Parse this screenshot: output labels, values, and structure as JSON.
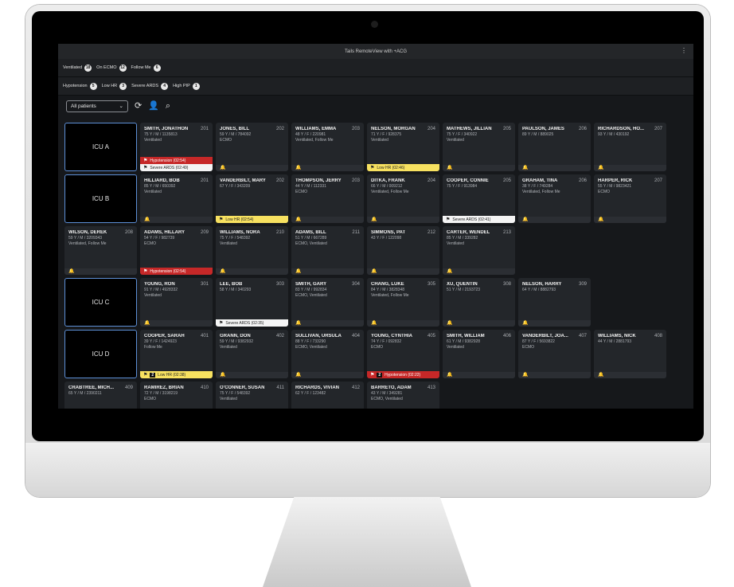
{
  "app": {
    "title": "Tails RemoteView with +ACG"
  },
  "filters_row1": [
    {
      "label": "Ventilated",
      "count": "18"
    },
    {
      "label": "On ECMO",
      "count": "12"
    },
    {
      "label": "Follow Me",
      "count": "6"
    }
  ],
  "filters_row2": [
    {
      "label": "Hypotension",
      "count": "5"
    },
    {
      "label": "Low HR",
      "count": "3"
    },
    {
      "label": "Severe ARDS",
      "count": "4"
    },
    {
      "label": "High PIP",
      "count": "1"
    }
  ],
  "toolbar": {
    "patient_filter": "All patients"
  },
  "grid": [
    [
      {
        "icu": "ICU A"
      },
      {
        "name": "SMITH, JONATHON",
        "bed": "201",
        "demo": "75 Y / M / 1135813",
        "status": "Ventilated",
        "alerts": [
          {
            "type": "red",
            "text": "Hypotension (02:54)"
          },
          {
            "type": "white",
            "text": "Severe ARDS (02:49)"
          }
        ]
      },
      {
        "name": "JONES, BILL",
        "bed": "202",
        "demo": "59 Y / M / 784092",
        "status": "ECMO",
        "alerts": []
      },
      {
        "name": "WILLIAMS, EMMA",
        "bed": "203",
        "demo": "48 Y / F / 220981",
        "status": "Ventilated, Follow Me",
        "alerts": []
      },
      {
        "name": "NELSON, MORGAN",
        "bed": "204",
        "demo": "71 Y / F / 928375",
        "status": "Ventilated",
        "alerts": [
          {
            "type": "yellow",
            "text": "Low HR (02:46)"
          }
        ]
      },
      {
        "name": "MATHEWS, JILLIAN",
        "bed": "205",
        "demo": "75 Y / F / 340922",
        "status": "Ventilated",
        "alerts": []
      },
      {
        "name": "PAULSON, JAMES",
        "bed": "206",
        "demo": "89 Y / M / 889025",
        "status": "",
        "alerts": []
      },
      {
        "name": "RICHARDSON, HO...",
        "bed": "207",
        "demo": "93 Y / M / 430192",
        "status": "",
        "alerts": []
      }
    ],
    [
      {
        "icu": "ICU B"
      },
      {
        "name": "HILLIARD, BOB",
        "bed": "201",
        "demo": "85 Y / M / 650392",
        "status": "Ventilated",
        "alerts": []
      },
      {
        "name": "VANDERBILT, MARY",
        "bed": "202",
        "demo": "67 Y / F / 343209",
        "status": "",
        "alerts": [
          {
            "type": "yellow",
            "text": "Low HR (02:54)"
          }
        ]
      },
      {
        "name": "THOMPSON, JERRY",
        "bed": "203",
        "demo": "44 Y / M / 112331",
        "status": "ECMO",
        "alerts": []
      },
      {
        "name": "DITKA, FRANK",
        "bed": "204",
        "demo": "66 Y / M / 009212",
        "status": "Ventilated, Follow Me",
        "alerts": []
      },
      {
        "name": "COOPER, CONNIE",
        "bed": "205",
        "demo": "75 Y / F / 913984",
        "status": "",
        "alerts": [
          {
            "type": "white",
            "text": "Severe ARDS (02:41)"
          }
        ]
      },
      {
        "name": "GRAHAM, TINA",
        "bed": "206",
        "demo": "38 Y / F / 749284",
        "status": "Ventilated, Follow Me",
        "alerts": []
      },
      {
        "name": "HARPER, RICK",
        "bed": "207",
        "demo": "55 Y / M / 9823421",
        "status": "ECMO",
        "alerts": []
      }
    ],
    [
      {
        "name": "WILSON, DEREK",
        "bed": "208",
        "demo": "59 Y / M / 3209343",
        "status": "Ventilated, Follow Me",
        "alerts": []
      },
      {
        "name": "ADAMS, HILLARY",
        "bed": "209",
        "demo": "54 Y / F / 982739",
        "status": "ECMO",
        "alerts": [
          {
            "type": "red",
            "text": "Hypotension (02:54)"
          }
        ]
      },
      {
        "name": "WILLIAMS, NORA",
        "bed": "210",
        "demo": "75 Y / F / 548392",
        "status": "Ventilated",
        "alerts": []
      },
      {
        "name": "ADAMS, BILL",
        "bed": "211",
        "demo": "51 Y / M / 667289",
        "status": "ECMO, Ventilated",
        "alerts": []
      },
      {
        "name": "SIMMONS, PAT",
        "bed": "212",
        "demo": "43 Y / F / 122098",
        "status": "",
        "alerts": []
      },
      {
        "name": "CARTER, WENDEL",
        "bed": "213",
        "demo": "85 Y / M / 339282",
        "status": "Ventilated",
        "alerts": []
      },
      {
        "empty": true
      },
      {
        "empty": true
      }
    ],
    [
      {
        "icu": "ICU C"
      },
      {
        "name": "YOUNG, RON",
        "bed": "301",
        "demo": "91 Y / M / 4928332",
        "status": "Ventilated",
        "alerts": []
      },
      {
        "name": "LEE, BOB",
        "bed": "303",
        "demo": "58 Y / M / 340293",
        "status": "",
        "alerts": [
          {
            "type": "white",
            "text": "Severe ARDS (02:35)"
          }
        ]
      },
      {
        "name": "SMITH, GARY",
        "bed": "304",
        "demo": "83 Y / M / 992834",
        "status": "ECMO, Ventilated",
        "alerts": []
      },
      {
        "name": "CHANG, LUKE",
        "bed": "305",
        "demo": "84 Y / M / 3828348",
        "status": "Ventilated, Follow Me",
        "alerts": []
      },
      {
        "name": "XU, QUENTIN",
        "bed": "308",
        "demo": "51 Y / M / 2193723",
        "status": "",
        "alerts": []
      },
      {
        "name": "NELSON, HARRY",
        "bed": "309",
        "demo": "64 Y / M / 8882793",
        "status": "",
        "alerts": []
      },
      {
        "empty": true
      }
    ],
    [
      {
        "icu": "ICU D"
      },
      {
        "name": "COOPER, SARAH",
        "bed": "401",
        "demo": "39 Y / F / 1424923",
        "status": "Follow Me",
        "alerts": [
          {
            "type": "yellow",
            "badge": "2",
            "text": "Low HR (02:38)"
          }
        ]
      },
      {
        "name": "GRANN, DON",
        "bed": "402",
        "demo": "59 Y / M / 9382932",
        "status": "Ventilated",
        "alerts": []
      },
      {
        "name": "SULLIVAN, URSULA",
        "bed": "404",
        "demo": "88 Y / F / 733290",
        "status": "ECMO, Ventilated",
        "alerts": []
      },
      {
        "name": "YOUNG, CYNTHIA",
        "bed": "405",
        "demo": "74 Y / F / 092832",
        "status": "ECMO",
        "alerts": [
          {
            "type": "red",
            "badge": "2",
            "text": "Hypotension (02:22)"
          }
        ]
      },
      {
        "name": "SMITH, WILLIAM",
        "bed": "406",
        "demo": "61 Y / M / 9382928",
        "status": "Ventilated",
        "alerts": []
      },
      {
        "name": "VANDERBILT, JOA...",
        "bed": "407",
        "demo": "87 Y / F / 5693822",
        "status": "ECMO",
        "alerts": []
      },
      {
        "name": "WILLIAMS, NICK",
        "bed": "408",
        "demo": "44 Y / M / 2881793",
        "status": "",
        "alerts": []
      }
    ],
    [
      {
        "name": "CRABTREE, MICH...",
        "bed": "409",
        "demo": "65 Y / M / 2390211",
        "status": "",
        "alerts": []
      },
      {
        "name": "RAMIREZ, BRIAN",
        "bed": "410",
        "demo": "72 Y / M / 3198219",
        "status": "ECMO",
        "alerts": []
      },
      {
        "name": "O'CONNER, SUSAN",
        "bed": "411",
        "demo": "75 Y / F / 548392",
        "status": "Ventilated",
        "alerts": []
      },
      {
        "name": "RICHARDS, VIVIAN",
        "bed": "412",
        "demo": "62 Y / F / 123482",
        "status": "",
        "alerts": []
      },
      {
        "name": "BARRETO, ADAM",
        "bed": "413",
        "demo": "43 Y / M / 349281",
        "status": "ECMO, Ventilated",
        "alerts": []
      },
      {
        "empty": true
      },
      {
        "empty": true
      },
      {
        "empty": true
      }
    ]
  ]
}
